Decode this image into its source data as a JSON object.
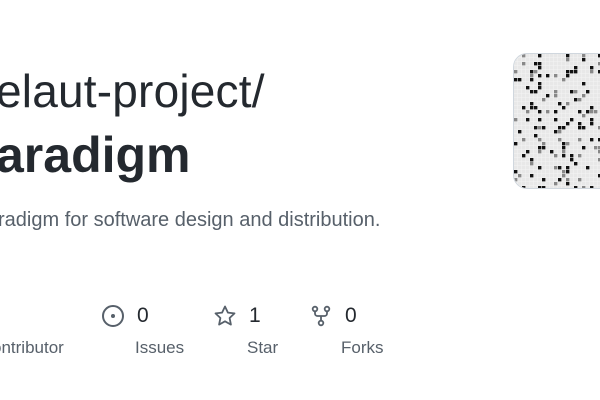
{
  "repo": {
    "owner_line": "elaut-project/",
    "name": "aradigm",
    "description": "radigm for software design and distribution."
  },
  "stats": {
    "contributors": {
      "label": "ontributor",
      "icon": "people-icon"
    },
    "issues": {
      "count": "0",
      "label": "Issues",
      "icon": "issue-opened-icon"
    },
    "stars": {
      "count": "1",
      "label": "Star",
      "icon": "star-icon"
    },
    "forks": {
      "count": "0",
      "label": "Forks",
      "icon": "repo-forked-icon"
    }
  },
  "colors": {
    "title": "#24292f",
    "muted": "#57606a",
    "icon": "#57606a"
  },
  "avatar": {
    "icon": "pixel-pattern-avatar"
  }
}
